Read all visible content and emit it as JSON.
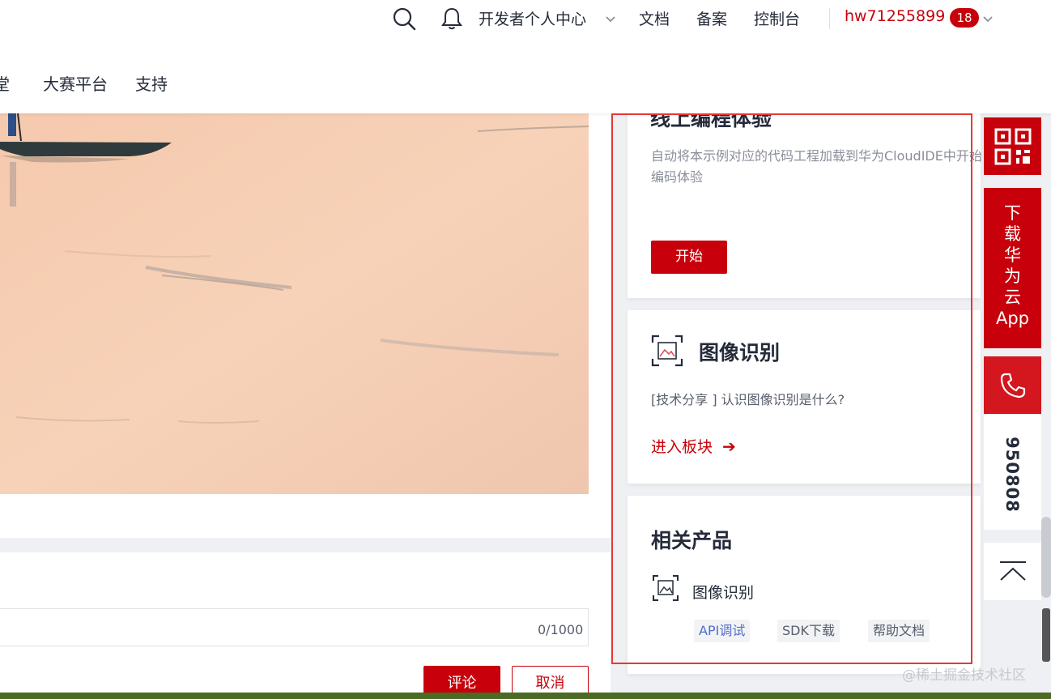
{
  "header": {
    "developer_center": "开发者个人中心",
    "docs": "文档",
    "filing": "备案",
    "console": "控制台",
    "username": "hw71255899",
    "badge": "18",
    "nav": [
      "堂",
      "大赛平台",
      "支持"
    ]
  },
  "online_coding": {
    "title": "线上编程体验",
    "description": "自动将本示例对应的代码工程加载到华为CloudIDE中开始编码体验",
    "start_label": "开始"
  },
  "image_recognition": {
    "title": "图像识别",
    "share_text": "[技术分享 ]  认识图像识别是什么?",
    "enter_label": "进入板块",
    "arrow": "➔"
  },
  "related_products": {
    "title": "相关产品",
    "product_name": "图像识别",
    "links": [
      "API调试",
      "SDK下载",
      "帮助文档"
    ]
  },
  "comment": {
    "counter": "0/1000",
    "submit_label": "评论",
    "cancel_label": "取消"
  },
  "float_tools": {
    "app_label_lines": [
      "下",
      "载",
      "华",
      "为",
      "云",
      "App"
    ],
    "phone_number": "950808"
  },
  "watermark": "@稀土掘金技术社区",
  "colors": {
    "brand_red": "#c7000b",
    "link_blue": "#526ecc",
    "outline_red": "#e53935"
  },
  "icons": {
    "search": "search-icon",
    "bell": "bell-icon",
    "chevron": "chevron-down-icon",
    "qr": "qr-code-icon",
    "phone": "phone-icon",
    "back_to_top": "back-to-top-icon",
    "image_recognition": "image-recognition-icon"
  }
}
